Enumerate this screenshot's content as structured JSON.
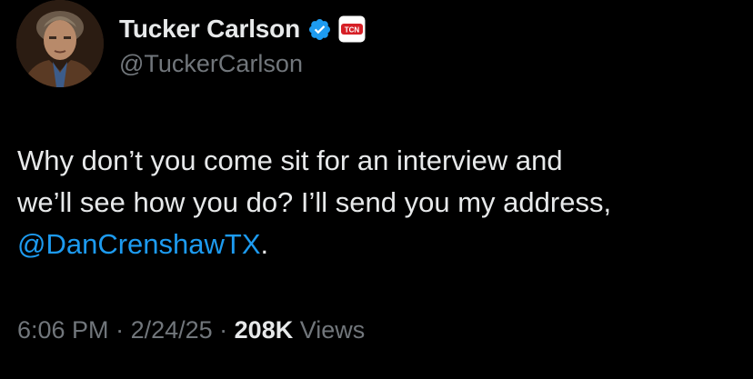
{
  "tweet": {
    "author": {
      "name": "Tucker Carlson",
      "handle": "@TuckerCarlson",
      "affiliation_badge": "TCN",
      "avatar_icon": "profile-photo"
    },
    "text": {
      "line1": "Why don’t you come sit for an interview and",
      "line2": "we’ll see how you do? I’ll send you my address,",
      "mention": "@DanCrenshawTX",
      "trailing": "."
    },
    "meta": {
      "time": "6:06 PM",
      "sep1": " · ",
      "date": "2/24/25",
      "sep2": " · ",
      "views_count": "208K",
      "views_label": " Views"
    }
  },
  "colors": {
    "background": "#000000",
    "text_primary": "#e7e9ea",
    "text_secondary": "#71767b",
    "link": "#1d9bf0",
    "verified": "#1d9bf0",
    "badge_red": "#d62027"
  }
}
